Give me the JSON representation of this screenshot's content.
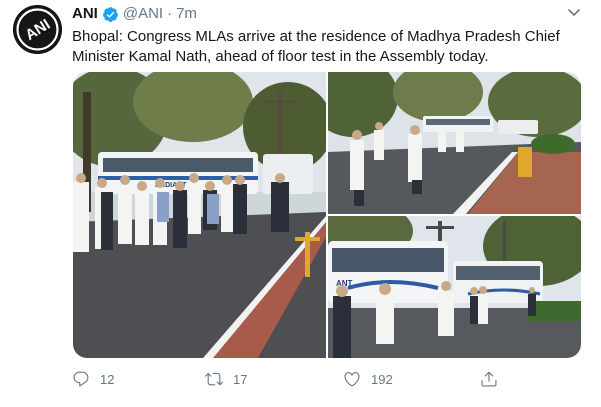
{
  "tweet": {
    "author": {
      "name": "ANI",
      "handle": "@ANI",
      "time": "7m",
      "separator": "·",
      "avatar_icon": "ani-logo",
      "avatar_text": "ANI",
      "verified_icon": "verified-badge-icon"
    },
    "text": "Bhopal: Congress MLAs arrive at the residence of Madhya Pradesh Chief Minister Kamal Nath, ahead of floor test in the Assembly today.",
    "media": {
      "photos": [
        {
          "bus_text": "RADIANT"
        },
        {
          "bus_text": ""
        },
        {
          "bus_text": "ANT"
        }
      ]
    },
    "actions": {
      "reply": {
        "icon": "reply-icon",
        "count": "12"
      },
      "retweet": {
        "icon": "retweet-icon",
        "count": "17"
      },
      "like": {
        "icon": "heart-icon",
        "count": "192"
      },
      "share": {
        "icon": "share-icon"
      }
    }
  },
  "colors": {
    "text": "#14171a",
    "secondary": "#657786",
    "verified": "#1da1f2"
  }
}
